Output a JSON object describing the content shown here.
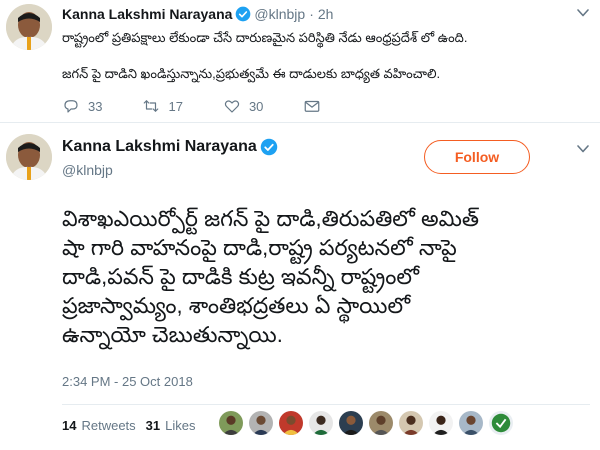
{
  "tweet1": {
    "author_name": "Kanna Lakshmi Narayana",
    "handle": "@klnbjp",
    "separator": "·",
    "time": "2h",
    "lines": [
      "రాష్ట్రంలో ప్రతిపక్షాలు లేకుండా చేసే దారుణమైన పరిస్థితి నేడు ఆంధ్రప్రదేశ్ లో ఉంది.",
      "జగన్ పై దాడిని ఖండిస్తున్నాను,ప్రభుత్వమే ఈ దాడులకు బాధ్యత వహించాలి."
    ],
    "reply_count": "33",
    "retweet_count": "17",
    "like_count": "30"
  },
  "tweet2": {
    "author_name": "Kanna Lakshmi Narayana",
    "handle": "@klnbjp",
    "follow_label": "Follow",
    "lines": [
      "విశాఖఎయిర్పోర్ట్ జగన్ పై దాడి,తిరుపతిలో అమిత్",
      "షా గారి వాహనంపై దాడి,రాష్ట్ర పర్యటనలో నాపై",
      "దాడి,పవన్ పై దాడికి కుట్ర ఇవన్నీ రాష్ట్రంలో",
      "ప్రజాస్వామ్యం, శాంతిభద్రతలు ఏ స్థాయిలో",
      "ఉన్నాయో చెబుతున్నాయి."
    ],
    "timestamp": "2:34 PM - 25 Oct 2018",
    "retweets_count": "14",
    "retweets_label": "Retweets",
    "likes_count": "31",
    "likes_label": "Likes"
  },
  "colors": {
    "accent": "#1da1f2",
    "follow": "#f45d22",
    "muted": "#657786"
  }
}
